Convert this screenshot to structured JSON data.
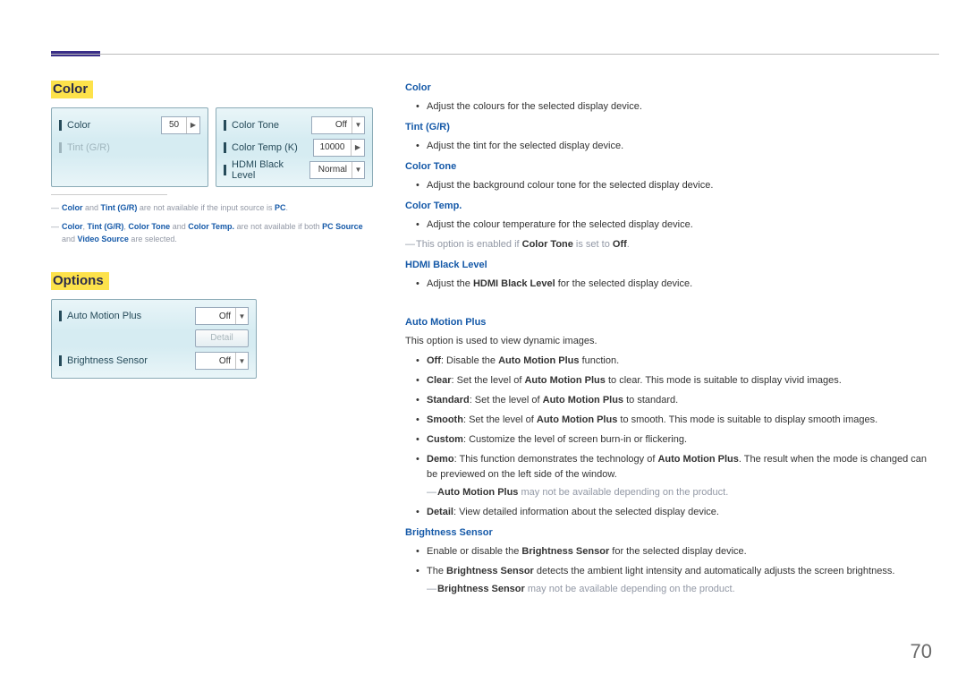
{
  "page_number": "70",
  "left": {
    "color_title": "Color",
    "options_title": "Options",
    "color_panel": {
      "color_label": "Color",
      "color_value": "50",
      "tint_label": "Tint (G/R)",
      "color_tone_label": "Color Tone",
      "color_tone_value": "Off",
      "color_temp_label": "Color Temp (K)",
      "color_temp_value": "10000",
      "hdmi_black_label": "HDMI Black Level",
      "hdmi_black_value": "Normal"
    },
    "fn1": {
      "a": "Color",
      "b": " and ",
      "c": "Tint (G/R)",
      "d": " are not available if the input source is ",
      "e": "PC",
      "f": "."
    },
    "fn2": {
      "a": "Color",
      "b": ", ",
      "c": "Tint (G/R)",
      "d": ", ",
      "e": "Color Tone",
      "f": " and ",
      "g": "Color Temp.",
      "h": " are not available if both ",
      "i": "PC Source",
      "j": " and ",
      "k": "Video Source",
      "l": " are selected."
    },
    "options_panel": {
      "amp_label": "Auto Motion Plus",
      "amp_value": "Off",
      "detail_label": "Detail",
      "brightness_label": "Brightness Sensor",
      "brightness_value": "Off"
    }
  },
  "right": {
    "color": {
      "h": "Color",
      "b1": "Adjust the colours for the selected display device."
    },
    "tint": {
      "h": "Tint (G/R)",
      "b1": "Adjust the tint for the selected display device."
    },
    "tone": {
      "h": "Color Tone",
      "b1": "Adjust the background colour tone for the selected display device."
    },
    "temp": {
      "h": "Color Temp.",
      "b1": "Adjust the colour temperature for the selected display device.",
      "note_a": "This option is enabled if ",
      "note_b": "Color Tone",
      "note_c": " is set to ",
      "note_d": "Off",
      "note_e": "."
    },
    "hdmi": {
      "h": "HDMI Black Level",
      "b1_a": "Adjust the ",
      "b1_b": "HDMI Black Level",
      "b1_c": " for the selected display device."
    },
    "amp": {
      "h": "Auto Motion Plus",
      "intro": "This option is used to view dynamic images.",
      "off_a": "Off",
      "off_b": ": Disable the ",
      "off_c": "Auto Motion Plus",
      "off_d": " function.",
      "clear_a": "Clear",
      "clear_b": ": Set the level of ",
      "clear_c": "Auto Motion Plus",
      "clear_d": " to clear. This mode is suitable to display vivid images.",
      "std_a": "Standard",
      "std_b": ": Set the level of ",
      "std_c": "Auto Motion Plus",
      "std_d": " to standard.",
      "smooth_a": "Smooth",
      "smooth_b": ": Set the level of ",
      "smooth_c": "Auto Motion Plus",
      "smooth_d": " to smooth. This mode is suitable to display smooth images.",
      "custom_a": "Custom",
      "custom_b": ": Customize the level of screen burn-in or flickering.",
      "demo_a": "Demo",
      "demo_b": ": This function demonstrates the technology of ",
      "demo_c": "Auto Motion Plus",
      "demo_d": ". The result when the mode is changed can be previewed on the left side of the window.",
      "note_a": "Auto Motion Plus",
      "note_b": " may not be available depending on the product.",
      "detail_a": "Detail",
      "detail_b": ": View detailed information about the selected display device."
    },
    "bs": {
      "h": "Brightness Sensor",
      "b1_a": "Enable or disable the ",
      "b1_b": "Brightness Sensor",
      "b1_c": " for the selected display device.",
      "b2_a": "The ",
      "b2_b": "Brightness Sensor",
      "b2_c": " detects the ambient light intensity and automatically adjusts the screen brightness.",
      "note_a": "Brightness Sensor",
      "note_b": " may not be available depending on the product."
    }
  }
}
